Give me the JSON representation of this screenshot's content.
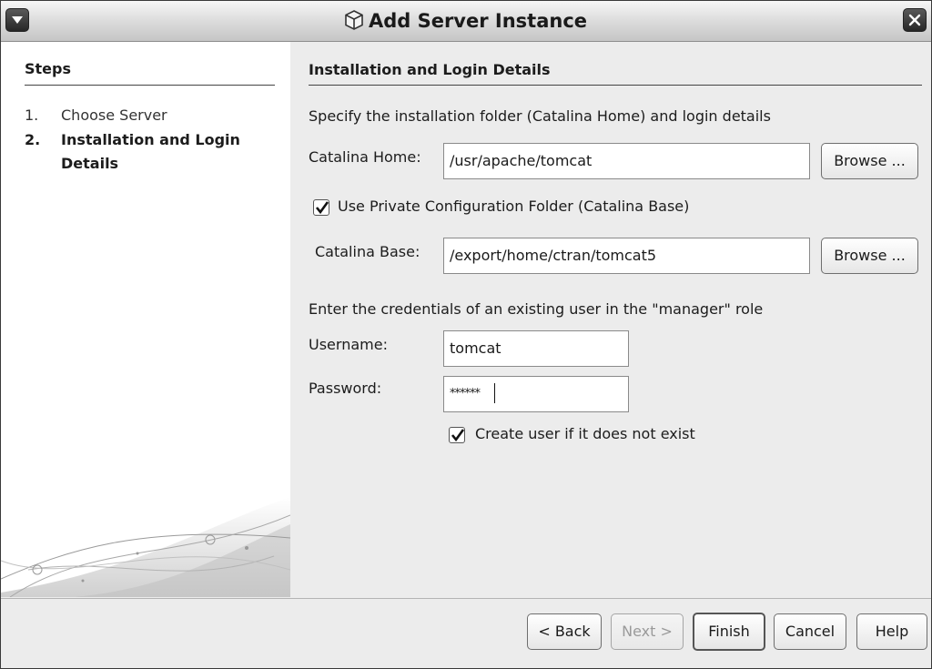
{
  "window": {
    "title": "Add Server Instance"
  },
  "steps": {
    "heading": "Steps",
    "items": [
      {
        "number": "1.",
        "label": "Choose Server"
      },
      {
        "number": "2.",
        "label": "Installation and Login Details"
      }
    ]
  },
  "main": {
    "section_title": "Installation and Login Details",
    "instructions": "Specify the installation folder (Catalina Home) and login details",
    "catalina_home": {
      "label": "Catalina Home:",
      "value": "/usr/apache/tomcat",
      "browse": "Browse ..."
    },
    "private_config": {
      "label": "Use Private Configuration Folder (Catalina Base)",
      "checked": true
    },
    "catalina_base": {
      "label": "Catalina Base:",
      "value": "/export/home/ctran/tomcat5",
      "browse": "Browse ..."
    },
    "credentials_note": "Enter the credentials of an existing user in the \"manager\" role",
    "username": {
      "label": "Username:",
      "value": "tomcat"
    },
    "password": {
      "label": "Password:",
      "value": "******"
    },
    "create_user": {
      "label": "Create user if it does not exist",
      "checked": true
    }
  },
  "buttons": {
    "back": "< Back",
    "next": "Next >",
    "finish": "Finish",
    "cancel": "Cancel",
    "help": "Help"
  },
  "icons": {
    "window_menu": "chevron-down-icon",
    "close": "close-icon",
    "title": "cube-icon"
  }
}
